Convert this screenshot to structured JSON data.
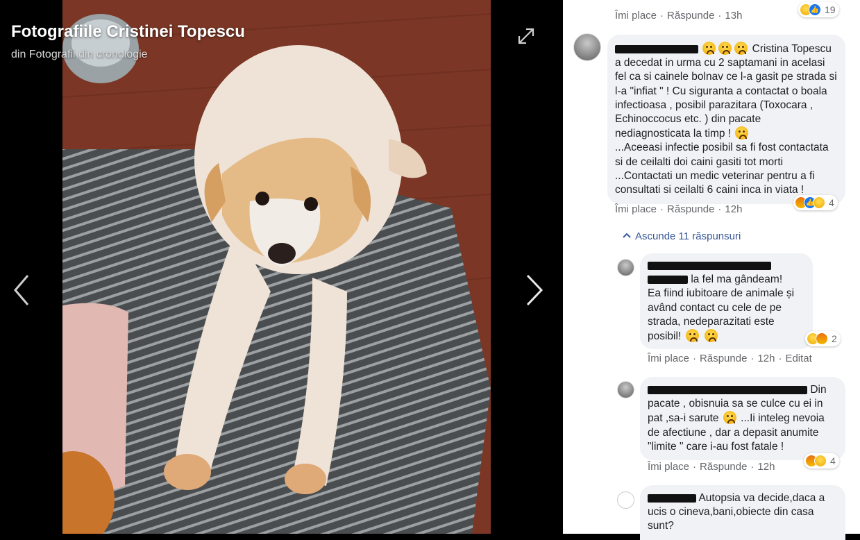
{
  "viewer": {
    "album_title": "Fotografiile Cristinei Topescu",
    "album_subtitle": "din Fotografii din cronologie"
  },
  "actions": {
    "like": "Îmi place",
    "reply": "Răspunde",
    "separator": "·",
    "edited": "Editat"
  },
  "thread": {
    "top_comment": {
      "time": "13h",
      "reactions_count": "19"
    },
    "main_comment": {
      "text": "Cristina Topescu a decedat in urma cu 2 saptamani in acelasi fel ca si cainele bolnav ce l-a gasit pe strada si l-a \"infiat \" ! Cu siguranta a contactat o boala infectioasa , posibil parazitara (Toxocara , Echinoccocus etc. ) din pacate nediagnosticata la timp !",
      "text2": "...Aceeasi infectie posibil sa fi fost contactata si de ceilalti doi caini gasiti tot morti ...Contactati un medic veterinar pentru a fi consultati si ceilalti 6 caini inca in viata !",
      "time": "12h",
      "reactions_count": "4"
    },
    "hide_replies": "Ascunde 11 răspunsuri",
    "replies": [
      {
        "text_a": "la fel ma gândeam!",
        "text_b": "Ea fiind iubitoare de animale și având contact cu cele de pe strada, nedeparazitati este posibil!",
        "time": "12h",
        "reactions_count": "2"
      },
      {
        "text_a": "Din",
        "text_b": "pacate , obisnuia sa se culce cu ei in pat ,sa-i sarute",
        "text_c": "...Ii inteleg nevoia de afectiune , dar a depasit anumite \"limite \" care i-au fost fatale !",
        "time": "12h",
        "reactions_count": "4"
      },
      {
        "text_a": "Autopsia va decide,daca a",
        "text_b": "ucis o cineva,bani,obiecte din casa sunt?"
      }
    ]
  },
  "colors": {
    "link": "#385898",
    "meta": "#65676b",
    "bubble": "#f0f2f5"
  },
  "icons": [
    "expand-icon",
    "chevron-left-icon",
    "chevron-right-icon",
    "chevron-up-icon",
    "sad-reaction-icon",
    "like-reaction-icon",
    "angry-reaction-icon",
    "wow-reaction-icon"
  ]
}
